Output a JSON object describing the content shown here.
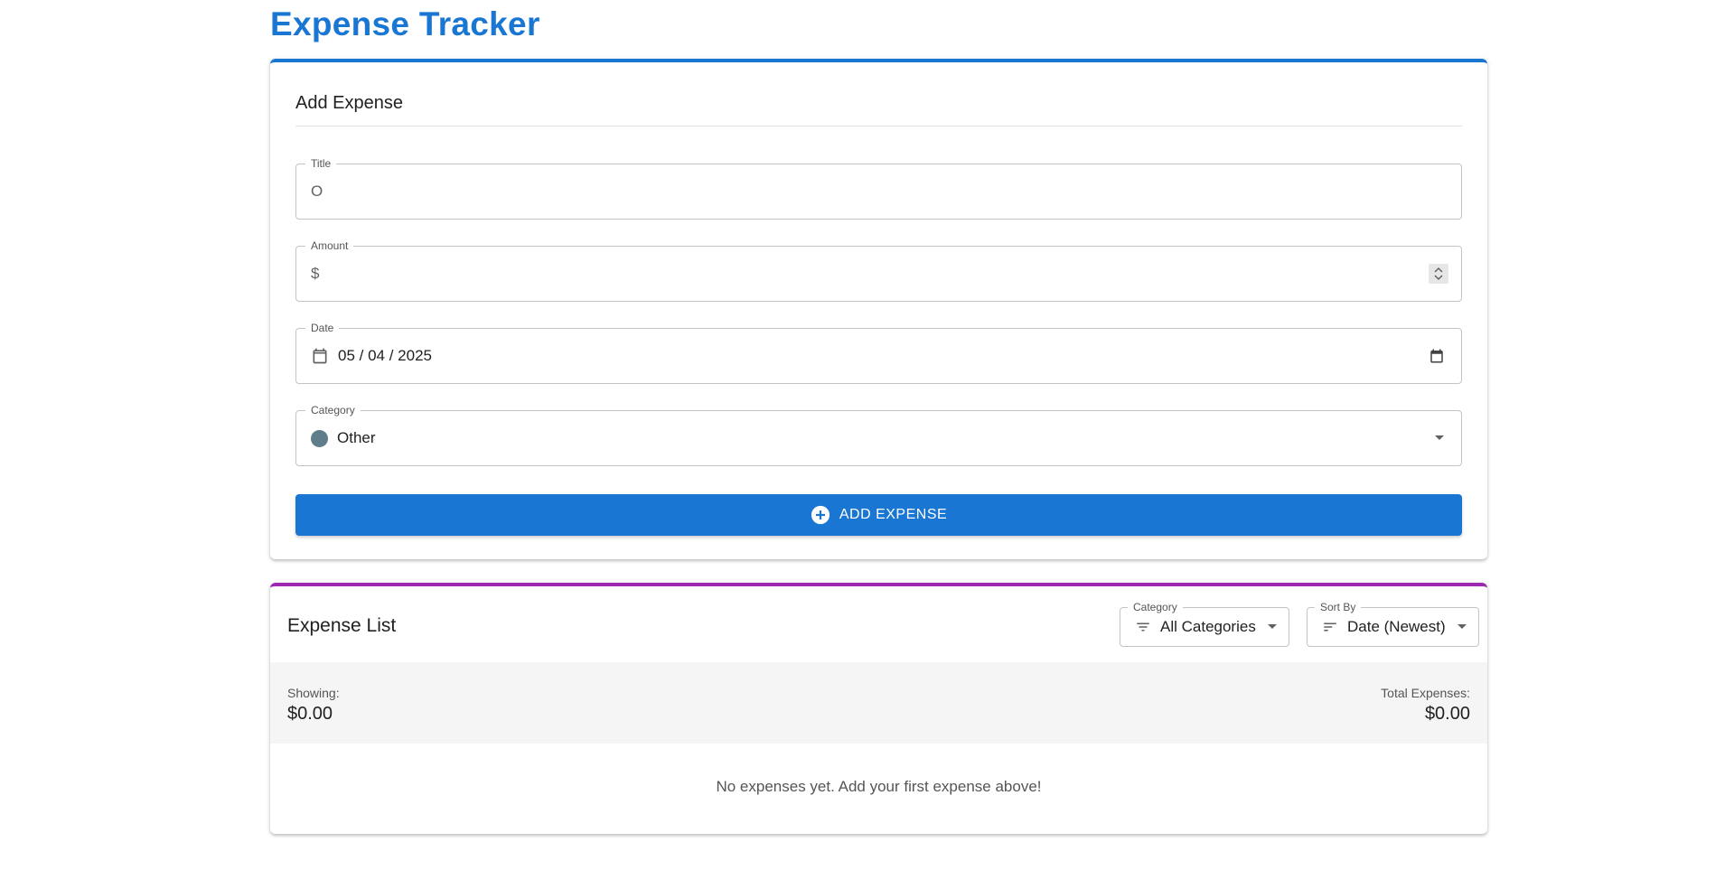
{
  "app_title": "Expense Tracker",
  "add_card": {
    "title": "Add Expense",
    "title_field": {
      "label": "Title",
      "value": "O"
    },
    "amount_field": {
      "label": "Amount",
      "prefix": "$",
      "value": ""
    },
    "date_field": {
      "label": "Date",
      "value": "05 / 04 / 2025"
    },
    "category_field": {
      "label": "Category",
      "value": "Other",
      "dot_color": "#607d8b"
    },
    "submit_label": "ADD EXPENSE"
  },
  "list_card": {
    "title": "Expense List",
    "category_filter": {
      "label": "Category",
      "value": "All Categories"
    },
    "sort_filter": {
      "label": "Sort By",
      "value": "Date (Newest)"
    },
    "showing": {
      "label": "Showing:",
      "value": "$0.00"
    },
    "total": {
      "label": "Total Expenses:",
      "value": "$0.00"
    },
    "empty_message": "No expenses yet. Add your first expense above!"
  },
  "colors": {
    "primary": "#1976d2",
    "list_accent": "#9c27b0"
  }
}
